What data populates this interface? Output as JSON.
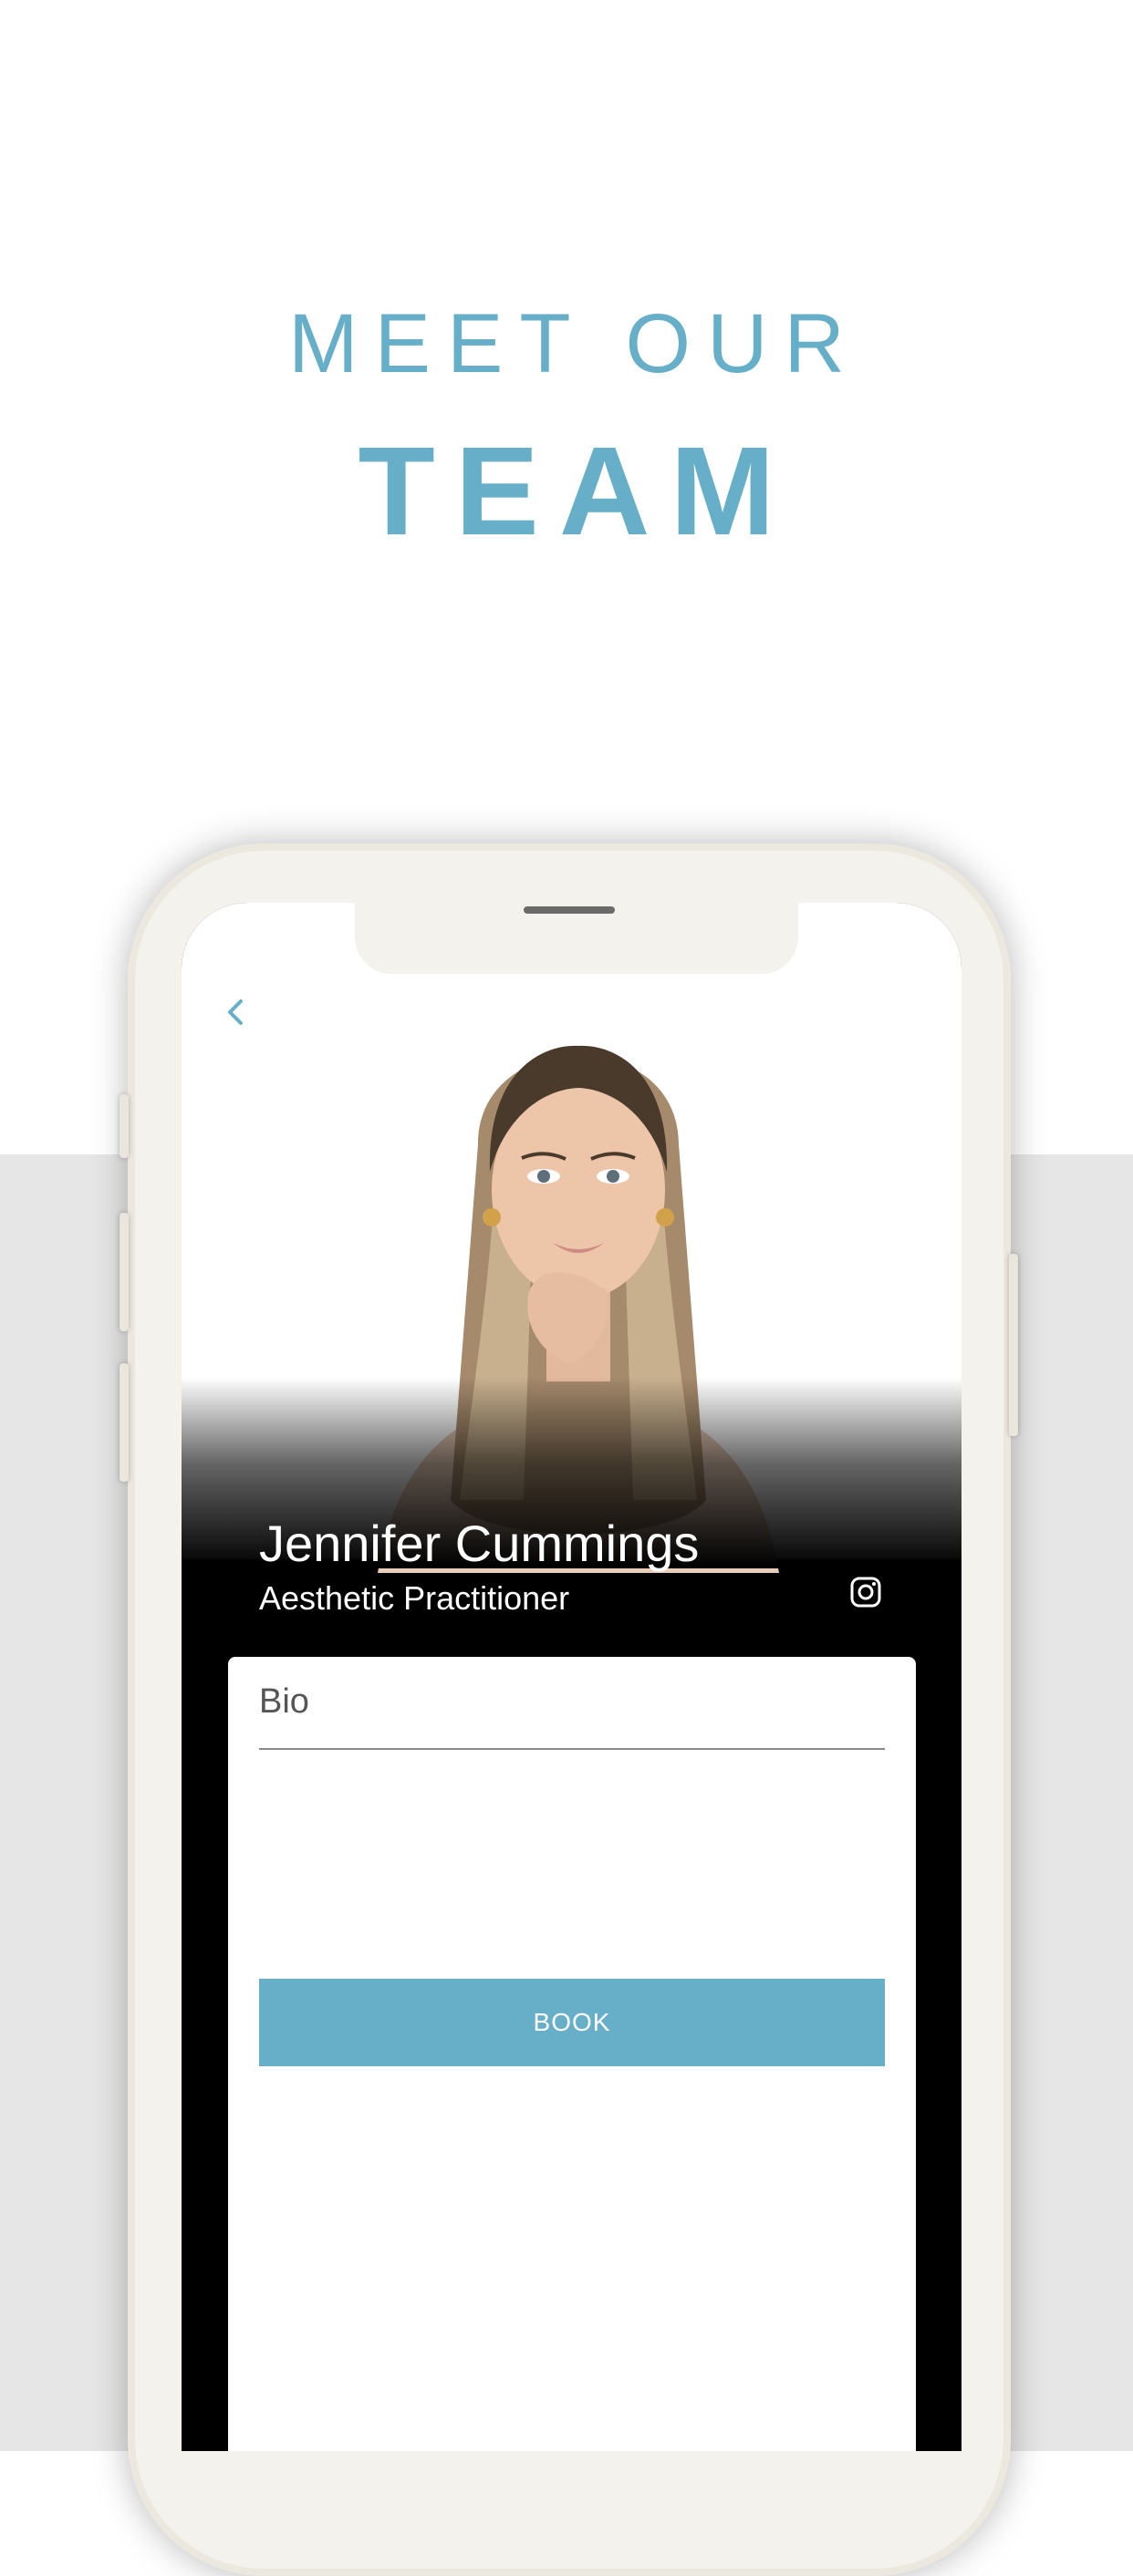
{
  "header": {
    "line1": "MEET OUR",
    "line2": "TEAM"
  },
  "profile": {
    "back_icon": "chevron-left-icon",
    "name": "Jennifer Cummings",
    "role": "Aesthetic Practitioner",
    "social_icon": "instagram-icon"
  },
  "card": {
    "bio_label": "Bio",
    "book_label": "BOOK"
  },
  "colors": {
    "accent": "#67afc8",
    "screen_bg": "#000000",
    "lower_bg": "#e6e6e6"
  }
}
